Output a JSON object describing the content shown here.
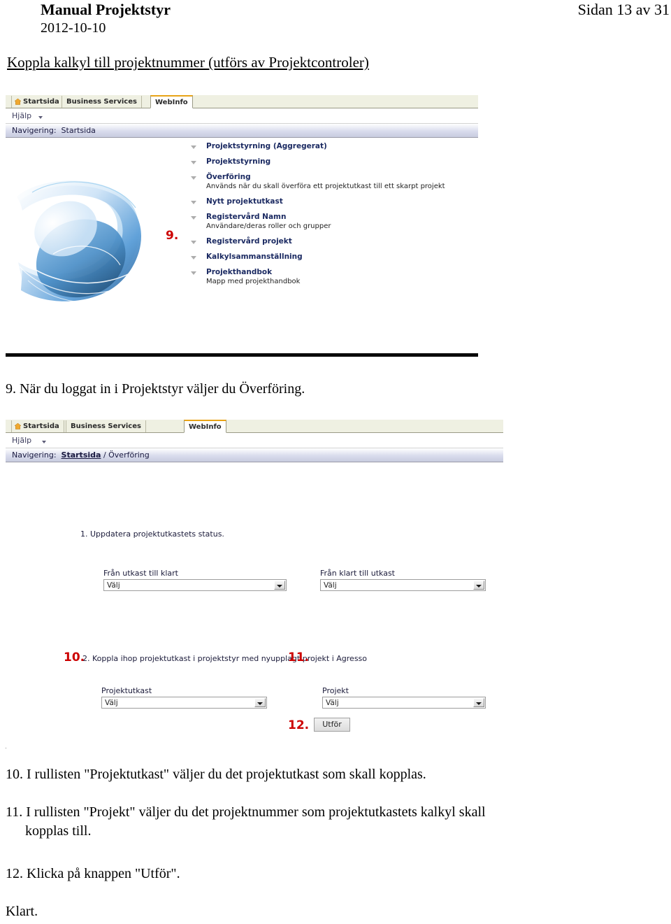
{
  "document": {
    "title": "Manual Projektstyr",
    "date": "2012-10-10",
    "page_label": "Sidan 13 av 31",
    "section_heading": "Koppla kalkyl till projektnummer (utförs av Projektcontroler)"
  },
  "screenshot1": {
    "tabs": [
      {
        "label": "Startsida",
        "active": false,
        "icon": "home-icon"
      },
      {
        "label": "Business Services",
        "active": false
      },
      {
        "label": "WebInfo",
        "active": true
      }
    ],
    "help_label": "Hjälp",
    "navigation": {
      "prefix": "Navigering:",
      "path": "Startsida"
    },
    "menu_items": [
      {
        "title": "Projektstyrning (Aggregerat)",
        "sub": ""
      },
      {
        "title": "Projektstyrning",
        "sub": ""
      },
      {
        "title": "Överföring",
        "sub": "Används när du skall överföra ett projektutkast till ett skarpt projekt"
      },
      {
        "title": "Nytt projektutkast",
        "sub": ""
      },
      {
        "title": "Registervård Namn",
        "sub": "Användare/deras roller och grupper"
      },
      {
        "title": "Registervård projekt",
        "sub": ""
      },
      {
        "title": "Kalkylsammanställning",
        "sub": ""
      },
      {
        "title": "Projekthandbok",
        "sub": "Mapp med projekthandbok"
      }
    ]
  },
  "screenshot2": {
    "tabs": [
      {
        "label": "Startsida",
        "active": false,
        "icon": "home-icon"
      },
      {
        "label": "Business Services",
        "active": false
      },
      {
        "label": "WebInfo",
        "active": true
      }
    ],
    "help_label": "Hjälp",
    "navigation": {
      "prefix": "Navigering:",
      "path_link": "Startsida",
      "path_rest": "/ Överföring"
    },
    "form_heading_1": "1. Uppdatera projektutkastets status.",
    "form_heading_2": "2. Koppla ihop projektutkast i projektstyr med nyupplagt projekt i Agresso",
    "fields": {
      "from_draft_to_done": {
        "label": "Från utkast till klart",
        "value": "Välj"
      },
      "from_done_to_draft": {
        "label": "Från klart till utkast",
        "value": "Välj"
      },
      "projektutkast": {
        "label": "Projektutkast",
        "value": "Välj"
      },
      "projekt": {
        "label": "Projekt",
        "value": "Välj"
      }
    },
    "execute_button": "Utför"
  },
  "markers": {
    "m9": "9.",
    "m10": "10.",
    "m11": "11.",
    "m12": "12."
  },
  "steps": {
    "step9": "9. När du loggat in i Projektstyr väljer du Överföring.",
    "step10": "10. I rullisten \"Projektutkast\" väljer du det projektutkast som skall kopplas.",
    "step11_line1": "11. I rullisten \"Projekt\" väljer du det projektnummer som projektutkastets kalkyl skall",
    "step11_line2": "kopplas till.",
    "step12": "12. Klicka på knappen \"Utför\".",
    "done": "Klart."
  },
  "colors": {
    "marker_red": "#cc0000",
    "menu_blue": "#1b2a62",
    "tab_active_accent": "#e8a317",
    "tabbar_bg": "#eff0e2"
  }
}
